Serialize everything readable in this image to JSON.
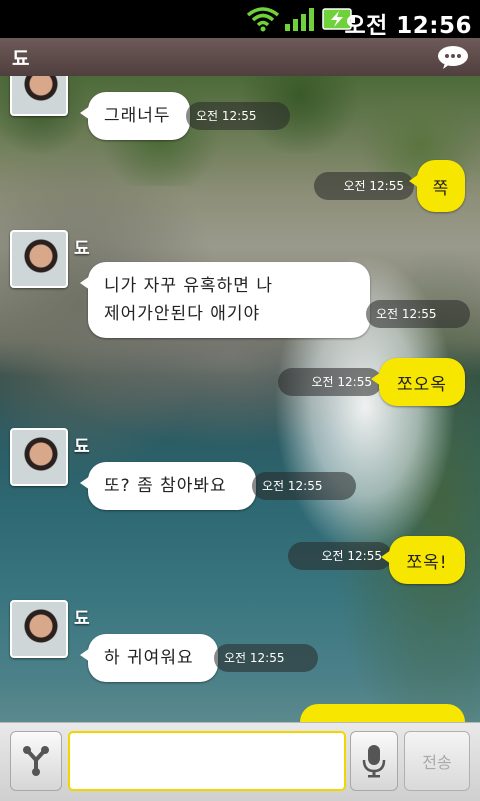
{
  "status_bar": {
    "clock": "오전 12:56"
  },
  "header": {
    "title": "됴"
  },
  "messages": [
    {
      "direction": "in",
      "sender": "",
      "text": "그래너두",
      "time": "오전 12:55"
    },
    {
      "direction": "out",
      "text": "쪽",
      "time": "오전 12:55"
    },
    {
      "direction": "in",
      "sender": "됴",
      "text_line1": "니가 자꾸 유혹하면 나",
      "text_line2": "제어가안된다 애기야",
      "time": "오전 12:55"
    },
    {
      "direction": "out",
      "text": "쪼오옥",
      "time": "오전 12:55"
    },
    {
      "direction": "in",
      "sender": "됴",
      "text": "또? 좀 참아봐요",
      "time": "오전 12:55"
    },
    {
      "direction": "out",
      "text": "쪼옥!",
      "time": "오전 12:55"
    },
    {
      "direction": "in",
      "sender": "됴",
      "text": "하 귀여워요",
      "time": "오전 12:55"
    }
  ],
  "input": {
    "value": "",
    "send_label": "전송"
  },
  "colors": {
    "out_bubble": "#f7e600",
    "in_bubble": "#ffffff",
    "title_bar": "#5e4b4a",
    "input_border": "#f2d600"
  },
  "icons": [
    "wifi-icon",
    "signal-icon",
    "battery-charging-icon",
    "chat-menu-icon",
    "share-icon",
    "microphone-icon"
  ]
}
